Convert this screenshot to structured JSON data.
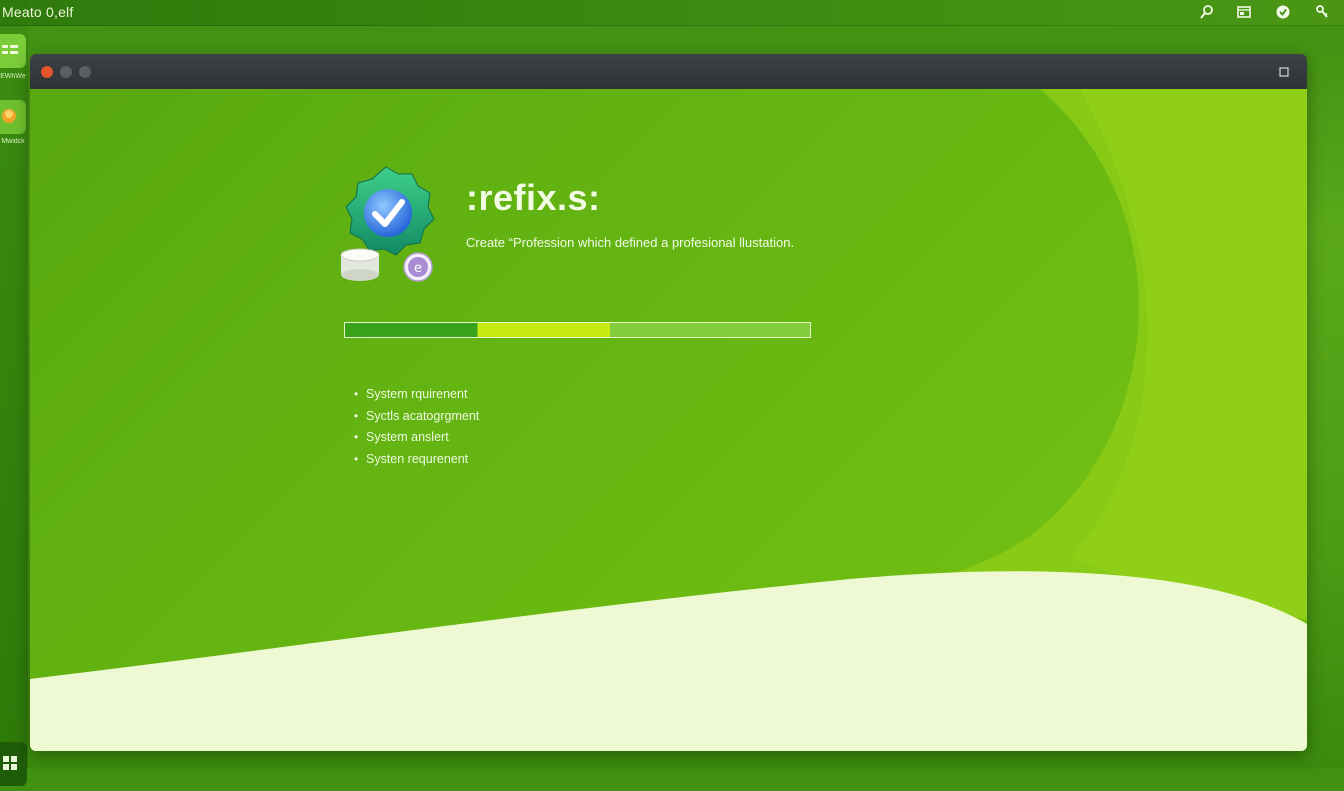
{
  "topbar": {
    "title": "Meato 0,elf",
    "tray_icons": [
      "search-icon",
      "window-icon",
      "shield-icon",
      "key-icon"
    ]
  },
  "dock": {
    "apps": [
      {
        "icon": "grid-list-icon",
        "label": "EWhWe"
      },
      {
        "icon": "basket-icon",
        "label": "Mwidck"
      }
    ],
    "start_icon": "start-grid-icon"
  },
  "window": {
    "controls": [
      "close-dot",
      "minimize-dot",
      "maximize-dot"
    ],
    "right_controls": [
      "maximize-icon",
      "close-icon"
    ]
  },
  "main": {
    "app_name": ":refix.s:",
    "tagline": "Create “Profession which defined a profesional llustation.",
    "progress": 0.57,
    "requirements": [
      "System rquirenent",
      "Syctls acatogrgment",
      "System anslert",
      "Systen requrenent"
    ]
  },
  "colors": {
    "accent": "#5fae12",
    "progress_done": "#3ba31b",
    "progress_highlight": "#c7ea12",
    "titlebar": "#33383b",
    "close_dot": "#e4552b"
  }
}
